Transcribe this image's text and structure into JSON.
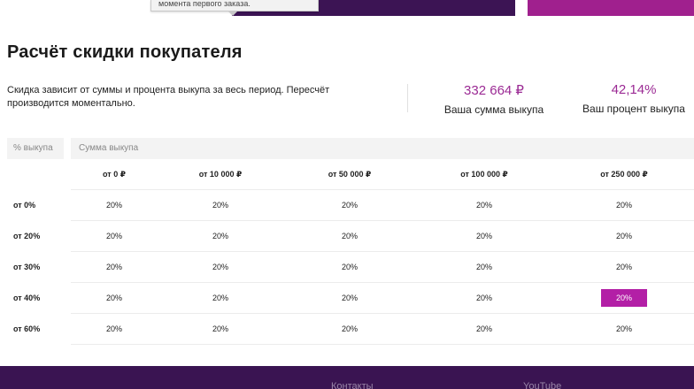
{
  "tooltip": {
    "text": "момента первого заказа."
  },
  "page": {
    "title": "Расчёт скидки покупателя"
  },
  "description": "Скидка зависит от суммы и процента выкупа за весь период. Пересчёт производится моментально.",
  "stats": [
    {
      "value": "332 664 ₽",
      "label": "Ваша сумма выкупа"
    },
    {
      "value": "42,14%",
      "label": "Ваш процент выкупа"
    }
  ],
  "table": {
    "row_header": "% выкупа",
    "col_header": "Сумма выкупа",
    "columns": [
      "от 0 ₽",
      "от 10 000 ₽",
      "от 50 000 ₽",
      "от 100 000 ₽",
      "от 250 000 ₽"
    ],
    "rows": [
      {
        "label": "от 0%",
        "cells": [
          "20%",
          "20%",
          "20%",
          "20%",
          "20%"
        ]
      },
      {
        "label": "от 20%",
        "cells": [
          "20%",
          "20%",
          "20%",
          "20%",
          "20%"
        ]
      },
      {
        "label": "от 30%",
        "cells": [
          "20%",
          "20%",
          "20%",
          "20%",
          "20%"
        ]
      },
      {
        "label": "от 40%",
        "cells": [
          "20%",
          "20%",
          "20%",
          "20%",
          "20%"
        ]
      },
      {
        "label": "от 60%",
        "cells": [
          "20%",
          "20%",
          "20%",
          "20%",
          "20%"
        ]
      }
    ],
    "highlighted": {
      "row": 3,
      "col": 4,
      "color": "#b31fa6"
    }
  },
  "footer": {
    "links": [
      "Контакты",
      "YouTube"
    ]
  },
  "colors": {
    "accent": "#9b2a94",
    "footer_bg": "#3a1452",
    "banner_dark": "#3c1454",
    "banner_magenta": "#a0208e"
  }
}
